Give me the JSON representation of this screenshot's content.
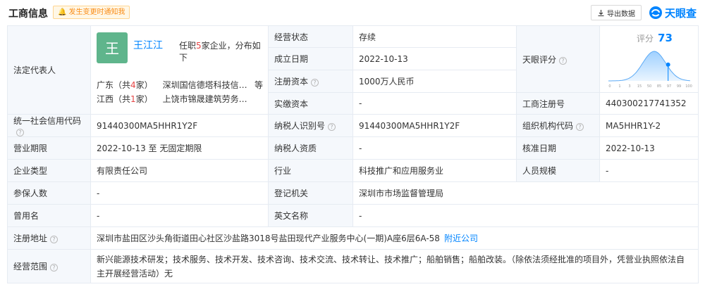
{
  "header": {
    "title": "工商信息",
    "notify_label": "发生变更时通知我",
    "export_label": "导出数据",
    "logo_text": "天眼查"
  },
  "legal_rep": {
    "label": "法定代表人",
    "avatar_char": "王",
    "name": "王江江",
    "duty_prefix": "任职",
    "duty_count": "5",
    "duty_suffix": "家企业，分布如下",
    "regions": [
      {
        "prefix": "广东（共",
        "count": "4",
        "suffix": "家）",
        "company": "深圳国信德塔科技信…",
        "more": "等"
      },
      {
        "prefix": "江西（共",
        "count": "1",
        "suffix": "家）",
        "company": "上饶市锦晟建筑劳务…",
        "more": ""
      }
    ]
  },
  "rows_top": [
    {
      "label": "经营状态",
      "value": "存续"
    },
    {
      "label": "成立日期",
      "value": "2022-10-13"
    },
    {
      "label": "注册资本",
      "value": "1000万人民币"
    },
    {
      "label": "实缴资本",
      "value": "-"
    }
  ],
  "tianyan": {
    "label": "天眼评分",
    "score_label": "评分",
    "score": "73",
    "score_value": 73,
    "axis_ticks": [
      "0",
      "1",
      "3",
      "15",
      "50",
      "85",
      "97",
      "99",
      "100"
    ],
    "reg_no_label": "工商注册号",
    "reg_no": "440300217741352"
  },
  "rows": [
    [
      {
        "label": "统一社会信用代码",
        "help": true,
        "value": "91440300MA5HHR1Y2F"
      },
      {
        "label": "纳税人识别号",
        "help": true,
        "value": "91440300MA5HHR1Y2F"
      },
      {
        "label": "组织机构代码",
        "help": true,
        "value": "MA5HHR1Y-2"
      }
    ],
    [
      {
        "label": "营业期限",
        "value": "2022-10-13 至 无固定期限"
      },
      {
        "label": "纳税人资质",
        "value": "-"
      },
      {
        "label": "核准日期",
        "value": "2022-10-13"
      }
    ],
    [
      {
        "label": "企业类型",
        "value": "有限责任公司"
      },
      {
        "label": "行业",
        "value": "科技推广和应用服务业"
      },
      {
        "label": "人员规模",
        "value": "-"
      }
    ]
  ],
  "rows_two": [
    {
      "l1": "参保人数",
      "v1": "-",
      "l2": "登记机关",
      "v2": "深圳市市场监督管理局"
    },
    {
      "l1": "曾用名",
      "v1": "-",
      "l2": "英文名称",
      "v2": "-"
    }
  ],
  "address": {
    "label": "注册地址",
    "value": "深圳市盐田区沙头角街道田心社区沙盐路3018号盐田现代产业服务中心(一期)A座6层6A-58",
    "link": "附近公司"
  },
  "scope": {
    "label": "经营范围",
    "value": "新兴能源技术研发；技术服务、技术开发、技术咨询、技术交流、技术转让、技术推广；船舶销售；船舶改装。（除依法须经批准的项目外，凭营业执照依法自主开展经营活动）无"
  }
}
